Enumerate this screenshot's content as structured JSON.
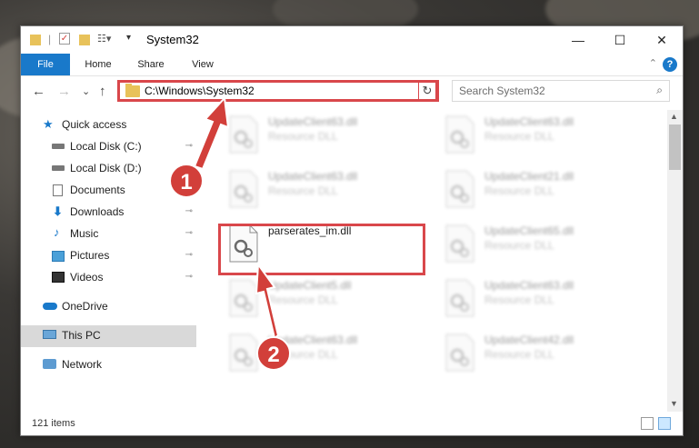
{
  "window": {
    "title": "System32",
    "controls": {
      "minimize": "—",
      "maximize": "☐",
      "close": "✕"
    }
  },
  "ribbon": {
    "tabs": [
      "File",
      "Home",
      "Share",
      "View"
    ],
    "help": "?",
    "collapse_icon": "chevron-up-icon"
  },
  "navigation": {
    "back": "←",
    "forward": "→",
    "recent": "⌄",
    "up": "↑",
    "address_path": "C:\\Windows\\System32",
    "refresh": "↻",
    "search_placeholder": "Search System32",
    "search_icon": "magnifier-icon"
  },
  "sidebar": {
    "items": [
      {
        "label": "Quick access",
        "icon": "star-icon",
        "pinned": false
      },
      {
        "label": "Local Disk (C:)",
        "icon": "drive-icon",
        "pinned": true
      },
      {
        "label": "Local Disk (D:)",
        "icon": "drive-icon",
        "pinned": true
      },
      {
        "label": "Documents",
        "icon": "documents-icon",
        "pinned": true
      },
      {
        "label": "Downloads",
        "icon": "download-icon",
        "pinned": true
      },
      {
        "label": "Music",
        "icon": "music-icon",
        "pinned": true
      },
      {
        "label": "Pictures",
        "icon": "pictures-icon",
        "pinned": true
      },
      {
        "label": "Videos",
        "icon": "videos-icon",
        "pinned": true
      },
      {
        "label": "OneDrive",
        "icon": "cloud-icon",
        "pinned": false
      },
      {
        "label": "This PC",
        "icon": "computer-icon",
        "pinned": false
      },
      {
        "label": "Network",
        "icon": "network-icon",
        "pinned": false
      }
    ],
    "pin_glyph": "📌"
  },
  "files": [
    {
      "name": "UpdateClient63.dll",
      "desc": "Resource DLL",
      "blurred": true
    },
    {
      "name": "UpdateClient63.dll",
      "desc": "Resource DLL",
      "blurred": true
    },
    {
      "name": "UpdateClient63.dll",
      "desc": "Resource DLL",
      "blurred": true
    },
    {
      "name": "UpdateClient21.dll",
      "desc": "Resource DLL",
      "blurred": true
    },
    {
      "name": "parserates_im.dll",
      "desc": "",
      "blurred": false
    },
    {
      "name": "UpdateClient65.dll",
      "desc": "Resource DLL",
      "blurred": true
    },
    {
      "name": "UpdateClient5.dll",
      "desc": "Resource DLL",
      "blurred": true
    },
    {
      "name": "UpdateClient63.dll",
      "desc": "Resource DLL",
      "blurred": true
    },
    {
      "name": "UpdateClient63.dll",
      "desc": "Resource DLL",
      "blurred": true
    },
    {
      "name": "UpdateClient42.dll",
      "desc": "Resource DLL",
      "blurred": true
    }
  ],
  "status": {
    "item_count": "121 items"
  },
  "callouts": [
    "1",
    "2"
  ],
  "colors": {
    "accent": "#1979ca",
    "callout": "#d23f3a",
    "selection": "#cce8ff"
  }
}
